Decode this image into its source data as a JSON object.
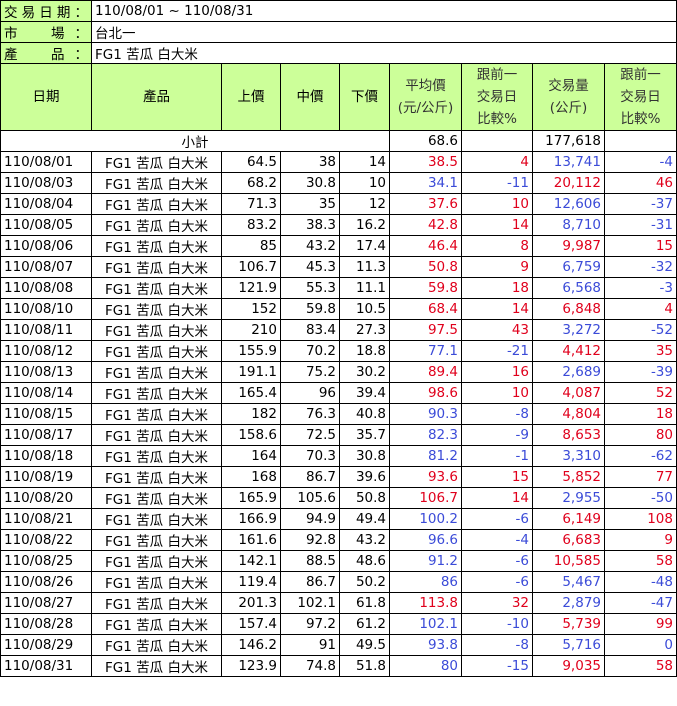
{
  "meta": {
    "date_label": "交易日期：",
    "date_value": "110/08/01 ~ 110/08/31",
    "market_label": "市　場：",
    "market_value": "台北一",
    "product_label": "產　品：",
    "product_value": "FG1 苦瓜 白大米"
  },
  "headers": {
    "date": "日期",
    "product": "產品",
    "high": "上價",
    "mid": "中價",
    "low": "下價",
    "avg": "平均價\n(元/公斤)",
    "avg_change": "跟前一\n交易日\n比較%",
    "volume": "交易量\n(公斤)",
    "volume_change": "跟前一\n交易日\n比較%"
  },
  "subtotal": {
    "label": "小計",
    "avg": "68.6",
    "volume": "177,618"
  },
  "colors": {
    "up": "#e0001c",
    "down": "#3b4bd8",
    "header_bg": "#ccff99"
  },
  "rows": [
    {
      "date": "110/08/01",
      "product": "FG1 苦瓜 白大米",
      "high": "64.5",
      "mid": "38",
      "low": "14",
      "avg": "38.5",
      "avg_change": "4",
      "volume": "13,741",
      "volume_change": "-4",
      "avg_color": "red",
      "ac_color": "red",
      "vol_color": "blue",
      "vc_color": "blue"
    },
    {
      "date": "110/08/03",
      "product": "FG1 苦瓜 白大米",
      "high": "68.2",
      "mid": "30.8",
      "low": "10",
      "avg": "34.1",
      "avg_change": "-11",
      "volume": "20,112",
      "volume_change": "46",
      "avg_color": "blue",
      "ac_color": "blue",
      "vol_color": "red",
      "vc_color": "red"
    },
    {
      "date": "110/08/04",
      "product": "FG1 苦瓜 白大米",
      "high": "71.3",
      "mid": "35",
      "low": "12",
      "avg": "37.6",
      "avg_change": "10",
      "volume": "12,606",
      "volume_change": "-37",
      "avg_color": "red",
      "ac_color": "red",
      "vol_color": "blue",
      "vc_color": "blue"
    },
    {
      "date": "110/08/05",
      "product": "FG1 苦瓜 白大米",
      "high": "83.2",
      "mid": "38.3",
      "low": "16.2",
      "avg": "42.8",
      "avg_change": "14",
      "volume": "8,710",
      "volume_change": "-31",
      "avg_color": "red",
      "ac_color": "red",
      "vol_color": "blue",
      "vc_color": "blue"
    },
    {
      "date": "110/08/06",
      "product": "FG1 苦瓜 白大米",
      "high": "85",
      "mid": "43.2",
      "low": "17.4",
      "avg": "46.4",
      "avg_change": "8",
      "volume": "9,987",
      "volume_change": "15",
      "avg_color": "red",
      "ac_color": "red",
      "vol_color": "red",
      "vc_color": "red"
    },
    {
      "date": "110/08/07",
      "product": "FG1 苦瓜 白大米",
      "high": "106.7",
      "mid": "45.3",
      "low": "11.3",
      "avg": "50.8",
      "avg_change": "9",
      "volume": "6,759",
      "volume_change": "-32",
      "avg_color": "red",
      "ac_color": "red",
      "vol_color": "blue",
      "vc_color": "blue"
    },
    {
      "date": "110/08/08",
      "product": "FG1 苦瓜 白大米",
      "high": "121.9",
      "mid": "55.3",
      "low": "11.1",
      "avg": "59.8",
      "avg_change": "18",
      "volume": "6,568",
      "volume_change": "-3",
      "avg_color": "red",
      "ac_color": "red",
      "vol_color": "blue",
      "vc_color": "blue"
    },
    {
      "date": "110/08/10",
      "product": "FG1 苦瓜 白大米",
      "high": "152",
      "mid": "59.8",
      "low": "10.5",
      "avg": "68.4",
      "avg_change": "14",
      "volume": "6,848",
      "volume_change": "4",
      "avg_color": "red",
      "ac_color": "red",
      "vol_color": "red",
      "vc_color": "red"
    },
    {
      "date": "110/08/11",
      "product": "FG1 苦瓜 白大米",
      "high": "210",
      "mid": "83.4",
      "low": "27.3",
      "avg": "97.5",
      "avg_change": "43",
      "volume": "3,272",
      "volume_change": "-52",
      "avg_color": "red",
      "ac_color": "red",
      "vol_color": "blue",
      "vc_color": "blue"
    },
    {
      "date": "110/08/12",
      "product": "FG1 苦瓜 白大米",
      "high": "155.9",
      "mid": "70.2",
      "low": "18.8",
      "avg": "77.1",
      "avg_change": "-21",
      "volume": "4,412",
      "volume_change": "35",
      "avg_color": "blue",
      "ac_color": "blue",
      "vol_color": "red",
      "vc_color": "red"
    },
    {
      "date": "110/08/13",
      "product": "FG1 苦瓜 白大米",
      "high": "191.1",
      "mid": "75.2",
      "low": "30.2",
      "avg": "89.4",
      "avg_change": "16",
      "volume": "2,689",
      "volume_change": "-39",
      "avg_color": "red",
      "ac_color": "red",
      "vol_color": "blue",
      "vc_color": "blue"
    },
    {
      "date": "110/08/14",
      "product": "FG1 苦瓜 白大米",
      "high": "165.4",
      "mid": "96",
      "low": "39.4",
      "avg": "98.6",
      "avg_change": "10",
      "volume": "4,087",
      "volume_change": "52",
      "avg_color": "red",
      "ac_color": "red",
      "vol_color": "red",
      "vc_color": "red"
    },
    {
      "date": "110/08/15",
      "product": "FG1 苦瓜 白大米",
      "high": "182",
      "mid": "76.3",
      "low": "40.8",
      "avg": "90.3",
      "avg_change": "-8",
      "volume": "4,804",
      "volume_change": "18",
      "avg_color": "blue",
      "ac_color": "blue",
      "vol_color": "red",
      "vc_color": "red"
    },
    {
      "date": "110/08/17",
      "product": "FG1 苦瓜 白大米",
      "high": "158.6",
      "mid": "72.5",
      "low": "35.7",
      "avg": "82.3",
      "avg_change": "-9",
      "volume": "8,653",
      "volume_change": "80",
      "avg_color": "blue",
      "ac_color": "blue",
      "vol_color": "red",
      "vc_color": "red"
    },
    {
      "date": "110/08/18",
      "product": "FG1 苦瓜 白大米",
      "high": "164",
      "mid": "70.3",
      "low": "30.8",
      "avg": "81.2",
      "avg_change": "-1",
      "volume": "3,310",
      "volume_change": "-62",
      "avg_color": "blue",
      "ac_color": "blue",
      "vol_color": "blue",
      "vc_color": "blue"
    },
    {
      "date": "110/08/19",
      "product": "FG1 苦瓜 白大米",
      "high": "168",
      "mid": "86.7",
      "low": "39.6",
      "avg": "93.6",
      "avg_change": "15",
      "volume": "5,852",
      "volume_change": "77",
      "avg_color": "red",
      "ac_color": "red",
      "vol_color": "red",
      "vc_color": "red"
    },
    {
      "date": "110/08/20",
      "product": "FG1 苦瓜 白大米",
      "high": "165.9",
      "mid": "105.6",
      "low": "50.8",
      "avg": "106.7",
      "avg_change": "14",
      "volume": "2,955",
      "volume_change": "-50",
      "avg_color": "red",
      "ac_color": "red",
      "vol_color": "blue",
      "vc_color": "blue"
    },
    {
      "date": "110/08/21",
      "product": "FG1 苦瓜 白大米",
      "high": "166.9",
      "mid": "94.9",
      "low": "49.4",
      "avg": "100.2",
      "avg_change": "-6",
      "volume": "6,149",
      "volume_change": "108",
      "avg_color": "blue",
      "ac_color": "blue",
      "vol_color": "red",
      "vc_color": "red"
    },
    {
      "date": "110/08/22",
      "product": "FG1 苦瓜 白大米",
      "high": "161.6",
      "mid": "92.8",
      "low": "43.2",
      "avg": "96.6",
      "avg_change": "-4",
      "volume": "6,683",
      "volume_change": "9",
      "avg_color": "blue",
      "ac_color": "blue",
      "vol_color": "red",
      "vc_color": "red"
    },
    {
      "date": "110/08/25",
      "product": "FG1 苦瓜 白大米",
      "high": "142.1",
      "mid": "88.5",
      "low": "48.6",
      "avg": "91.2",
      "avg_change": "-6",
      "volume": "10,585",
      "volume_change": "58",
      "avg_color": "blue",
      "ac_color": "blue",
      "vol_color": "red",
      "vc_color": "red"
    },
    {
      "date": "110/08/26",
      "product": "FG1 苦瓜 白大米",
      "high": "119.4",
      "mid": "86.7",
      "low": "50.2",
      "avg": "86",
      "avg_change": "-6",
      "volume": "5,467",
      "volume_change": "-48",
      "avg_color": "blue",
      "ac_color": "blue",
      "vol_color": "blue",
      "vc_color": "blue"
    },
    {
      "date": "110/08/27",
      "product": "FG1 苦瓜 白大米",
      "high": "201.3",
      "mid": "102.1",
      "low": "61.8",
      "avg": "113.8",
      "avg_change": "32",
      "volume": "2,879",
      "volume_change": "-47",
      "avg_color": "red",
      "ac_color": "red",
      "vol_color": "blue",
      "vc_color": "blue"
    },
    {
      "date": "110/08/28",
      "product": "FG1 苦瓜 白大米",
      "high": "157.4",
      "mid": "97.2",
      "low": "61.2",
      "avg": "102.1",
      "avg_change": "-10",
      "volume": "5,739",
      "volume_change": "99",
      "avg_color": "blue",
      "ac_color": "blue",
      "vol_color": "red",
      "vc_color": "red"
    },
    {
      "date": "110/08/29",
      "product": "FG1 苦瓜 白大米",
      "high": "146.2",
      "mid": "91",
      "low": "49.5",
      "avg": "93.8",
      "avg_change": "-8",
      "volume": "5,716",
      "volume_change": "0",
      "avg_color": "blue",
      "ac_color": "blue",
      "vol_color": "blue",
      "vc_color": "blue"
    },
    {
      "date": "110/08/31",
      "product": "FG1 苦瓜 白大米",
      "high": "123.9",
      "mid": "74.8",
      "low": "51.8",
      "avg": "80",
      "avg_change": "-15",
      "volume": "9,035",
      "volume_change": "58",
      "avg_color": "blue",
      "ac_color": "blue",
      "vol_color": "red",
      "vc_color": "red"
    }
  ]
}
